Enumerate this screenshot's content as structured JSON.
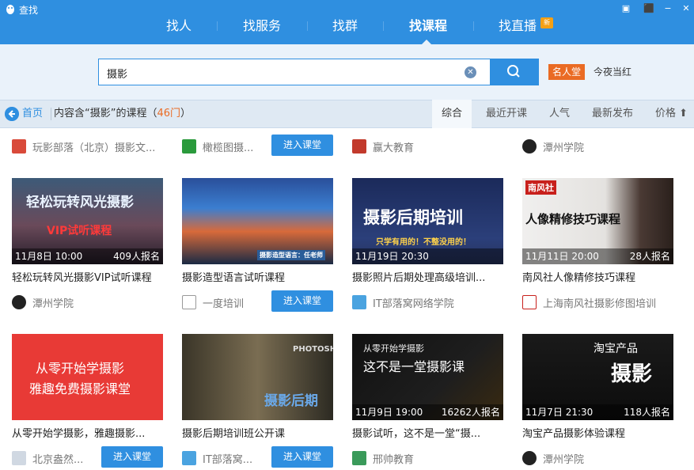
{
  "app": {
    "title": "查找"
  },
  "nav": {
    "tabs": [
      {
        "label": "找人"
      },
      {
        "label": "找服务"
      },
      {
        "label": "找群"
      },
      {
        "label": "找课程"
      },
      {
        "label": "找直播"
      }
    ],
    "new_badge": "新",
    "active_index": 3
  },
  "search": {
    "value": "摄影",
    "clear_icon": "clear-icon",
    "search_icon": "search-icon"
  },
  "celebrity": {
    "button_label": "名人堂",
    "link_label": "今夜当红"
  },
  "breadcrumb": {
    "home_label": "首页",
    "result_prefix": "内容含“摄影”的课程（",
    "result_count": "46门",
    "result_suffix": "）"
  },
  "sort_tabs": [
    {
      "label": "综合"
    },
    {
      "label": "最近开课"
    },
    {
      "label": "人气"
    },
    {
      "label": "最新发布"
    },
    {
      "label": "价格 ⬆"
    }
  ],
  "top_partial_row": {
    "providers": [
      "玩影部落（北京）摄影文...",
      "橄榄图摄...",
      "赢大教育",
      "潭州学院"
    ],
    "enter_label": "进入课堂"
  },
  "courses_row1": [
    {
      "thumb_text": "轻松玩转风光摄影",
      "thumb_sub": "VIP试听课程",
      "date": "11月8日 10:00",
      "count": "409人报名",
      "title": "轻松玩转风光摄影VIP试听课程",
      "provider": "潭州学院",
      "enter": ""
    },
    {
      "thumb_text": "摄影造型语言：任老师",
      "thumb_sub": "",
      "date": "",
      "count": "",
      "title": "摄影造型语言试听课程",
      "provider": "一度培训",
      "enter": "进入课堂"
    },
    {
      "thumb_text": "摄影后期培训",
      "thumb_sub": "只学有用的！不整没用的！",
      "date": "11月19日 20:30",
      "count": "",
      "title": "摄影照片后期处理高级培训...",
      "provider": "IT部落窝网络学院",
      "enter": ""
    },
    {
      "thumb_text": "人像精修技巧课程",
      "thumb_sub": "南风社",
      "date": "11月11日 20:00",
      "count": "28人报名",
      "title": "南风社人像精修技巧课程",
      "provider": "上海南风社摄影修图培训",
      "enter": ""
    }
  ],
  "courses_row2": [
    {
      "thumb_text": "从零开始学摄影",
      "thumb_sub": "雅趣免费摄影课堂",
      "date": "",
      "count": "",
      "title": "从零开始学摄影，雅趣摄影...",
      "provider": "北京盎然...",
      "enter": "进入课堂"
    },
    {
      "thumb_text": "摄影后期",
      "thumb_sub": "PHOTOSH",
      "date": "",
      "count": "",
      "title": "摄影后期培训班公开课",
      "provider": "IT部落窝...",
      "enter": "进入课堂"
    },
    {
      "thumb_text": "这不是一堂摄影课",
      "thumb_sub": "从零开始学摄影",
      "date": "11月9日 19:00",
      "count": "16262人报名",
      "title": "摄影试听，这不是一堂“摄...",
      "provider": "邢帅教育",
      "enter": ""
    },
    {
      "thumb_text": "摄影",
      "thumb_sub": "淘宝产品",
      "date": "11月7日 21:30",
      "count": "118人报名",
      "title": "淘宝产品摄影体验课程",
      "provider": "潭州学院",
      "enter": ""
    }
  ],
  "colors": {
    "header": "#2f8fe0",
    "accent_orange": "#ea6b24",
    "button_blue": "#2f8fe0"
  }
}
